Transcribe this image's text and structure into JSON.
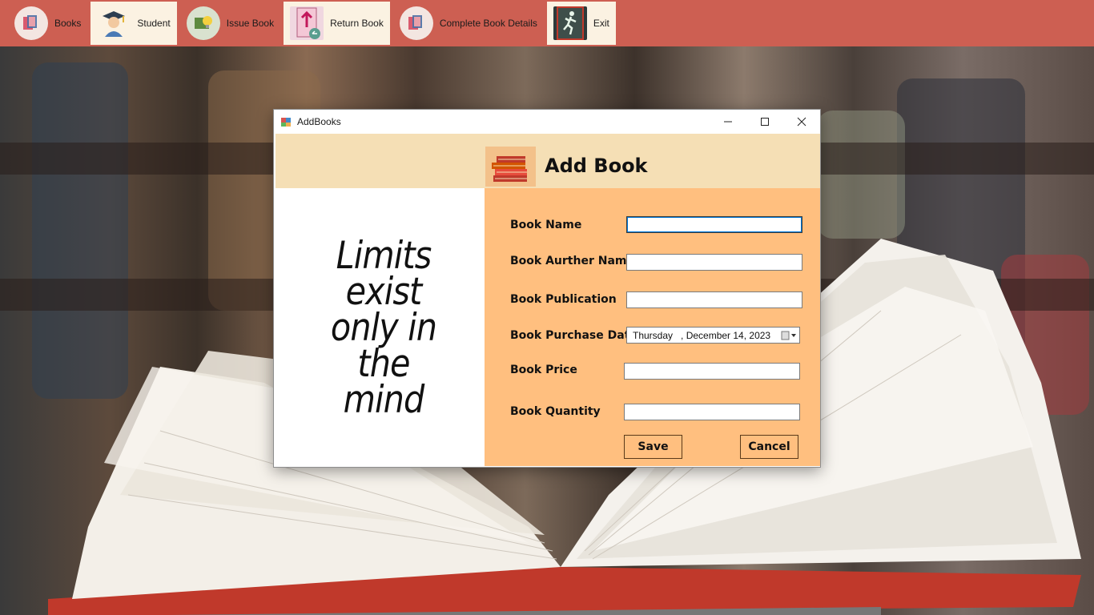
{
  "toolbar": {
    "items": [
      {
        "label": "Books",
        "icon": "books-icon"
      },
      {
        "label": "Student",
        "icon": "student-icon"
      },
      {
        "label": "Issue Book",
        "icon": "issue-book-icon"
      },
      {
        "label": "Return Book",
        "icon": "return-book-icon"
      },
      {
        "label": "Complete Book Details",
        "icon": "book-details-icon"
      },
      {
        "label": "Exit",
        "icon": "exit-icon"
      }
    ]
  },
  "window": {
    "title": "AddBooks",
    "heading": "Add Book"
  },
  "quote": {
    "line1": "Limits",
    "line2": "exist",
    "line3": "only in",
    "line4": "the mind"
  },
  "form": {
    "book_name_label": "Book Name",
    "book_name_value": "",
    "author_label": "Book Aurther Name",
    "author_value": "",
    "publication_label": "Book Publication",
    "publication_value": "",
    "purchase_date_label": "Book Purchase Date",
    "purchase_date_value": "Thursday   , December 14, 2023",
    "price_label": "Book Price",
    "price_value": "",
    "quantity_label": "Book Quantity",
    "quantity_value": "",
    "save_label": "Save",
    "cancel_label": "Cancel"
  },
  "colors": {
    "toolbar_bg": "#cd5f52",
    "header_band": "#f5dfb5",
    "form_bg": "#ffbf7f"
  }
}
